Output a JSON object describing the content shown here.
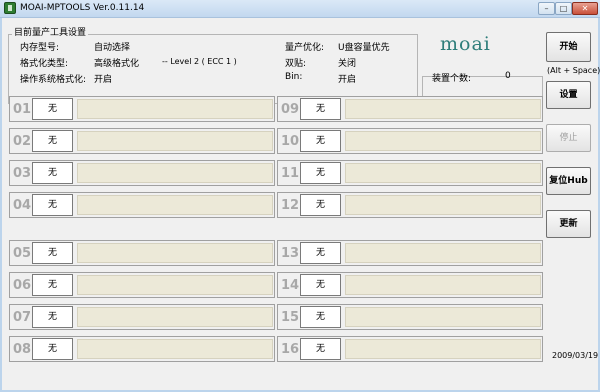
{
  "window": {
    "title": "MOAI-MPTOOLS Ver.0.11.14",
    "min_glyph": "–",
    "max_glyph": "□",
    "close_glyph": "✕"
  },
  "settings": {
    "legend": "目前量产工具设置",
    "memory_type_label": "内存型号:",
    "memory_type_value": "自动选择",
    "format_type_label": "格式化类型:",
    "format_type_value": "高级格式化",
    "level_text": "-- Level 2 ( ECC 1 )",
    "os_format_label": "操作系统格式化:",
    "os_format_value": "开启",
    "optimize_label": "量产优化:",
    "optimize_value": "U盘容量优先",
    "dual_paste_label": "双贴:",
    "dual_paste_value": "关闭",
    "bin_label": "Bin:",
    "bin_value": "开启"
  },
  "device_count": {
    "label": "装置个数:",
    "value": "0"
  },
  "logo_text": "moai",
  "buttons": {
    "start": "开始",
    "start_hint": "(Alt + Space)",
    "settings": "设置",
    "stop": "停止",
    "reset_hub": "复位Hub",
    "update": "更新"
  },
  "ports": [
    {
      "num": "01",
      "status": "无"
    },
    {
      "num": "02",
      "status": "无"
    },
    {
      "num": "03",
      "status": "无"
    },
    {
      "num": "04",
      "status": "无"
    },
    {
      "num": "05",
      "status": "无"
    },
    {
      "num": "06",
      "status": "无"
    },
    {
      "num": "07",
      "status": "无"
    },
    {
      "num": "08",
      "status": "无"
    },
    {
      "num": "09",
      "status": "无"
    },
    {
      "num": "10",
      "status": "无"
    },
    {
      "num": "11",
      "status": "无"
    },
    {
      "num": "12",
      "status": "无"
    },
    {
      "num": "13",
      "status": "无"
    },
    {
      "num": "14",
      "status": "无"
    },
    {
      "num": "15",
      "status": "无"
    },
    {
      "num": "16",
      "status": "无"
    }
  ],
  "date": "2009/03/19",
  "colors": {
    "logo": "#2e7d7a",
    "port_bar": "#ece9d8",
    "port_number": "#a8a8a8"
  }
}
